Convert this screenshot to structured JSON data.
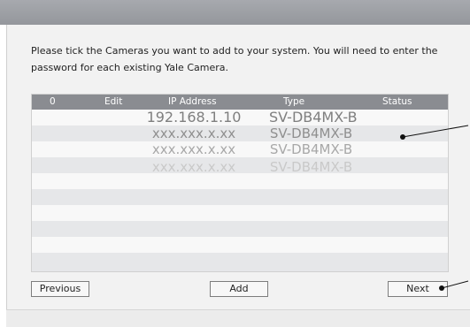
{
  "dialog": {
    "instructions": "Please tick the Cameras you want to add to your system. You will need to enter the password for each existing Yale Camera."
  },
  "table": {
    "headers": [
      "0",
      "Edit",
      "IP Address",
      "Type",
      "Status"
    ],
    "rows": [
      {
        "ip": "192.168.1.10",
        "type": "SV-DB4MX-B"
      },
      {
        "ip": "xxx.xxx.x.xx",
        "type": "SV-DB4MX-B"
      },
      {
        "ip": "xxx.xxx.x.xx",
        "type": "SV-DB4MX-B"
      },
      {
        "ip": "xxx.xxx.x.xx",
        "type": "SV-DB4MX-B"
      }
    ]
  },
  "buttons": {
    "previous": "Previous",
    "add": "Add",
    "next": "Next"
  },
  "colors": {
    "header_bg": "#8a8c91",
    "titlebar": "#9fa1a6",
    "callout": "#111111"
  }
}
